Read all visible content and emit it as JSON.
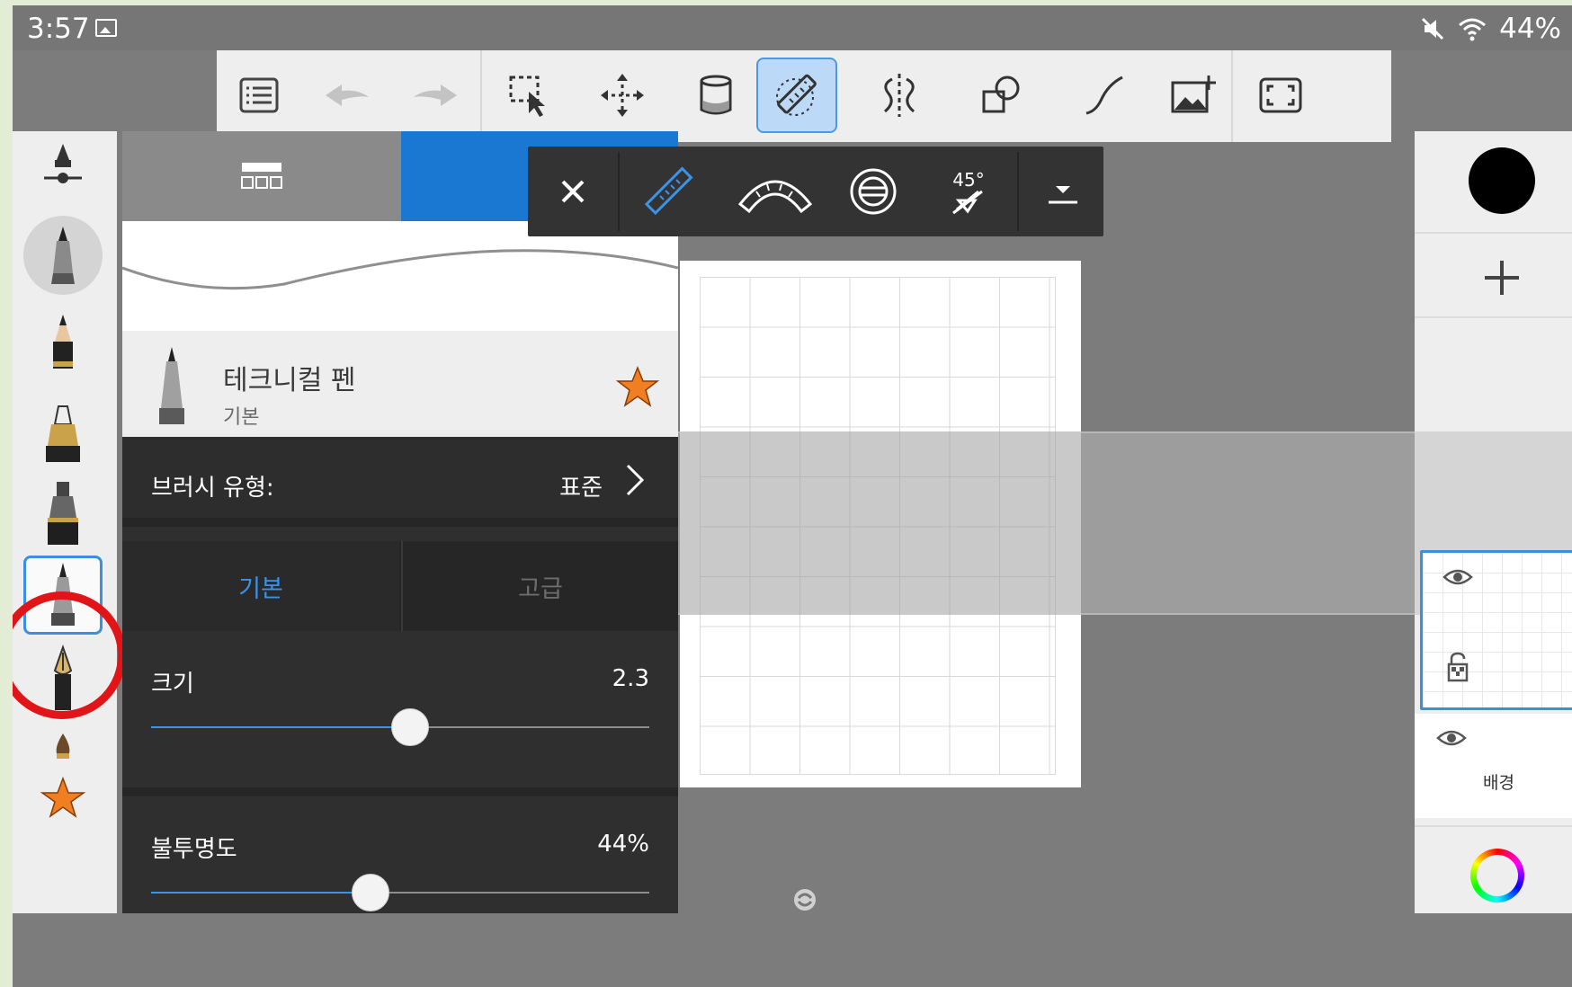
{
  "status_bar": {
    "time": "3:57",
    "battery": "44%",
    "icons": [
      "gallery-icon",
      "mute-icon",
      "wifi-icon"
    ]
  },
  "toolbar": {
    "items": [
      "list-icon",
      "undo-icon",
      "redo-icon",
      "selection-icon",
      "move-icon",
      "fill-bucket-icon",
      "ruler-icon",
      "symmetry-icon",
      "shapes-icon",
      "curve-icon",
      "add-image-icon",
      "fullscreen-icon"
    ],
    "active": "ruler-icon"
  },
  "ruler_bar": {
    "items": [
      "close-icon",
      "straight-ruler-icon",
      "ellipse-ruler-icon",
      "french-curve-icon",
      "angle-snap-icon",
      "collapse-icon"
    ],
    "angle_label": "45°"
  },
  "brush_panel": {
    "brush_name": "테크니컬 펜",
    "brush_category": "기본",
    "brush_type_label": "브러시 유형:",
    "brush_type_value": "표준",
    "tab_basic": "기본",
    "tab_advanced": "고급",
    "size_label": "크기",
    "size_value": "2.3",
    "size_fraction": 0.52,
    "opacity_label": "불투명도",
    "opacity_value": "44%",
    "opacity_fraction": 0.44
  },
  "layers": {
    "background_label": "배경"
  },
  "colors": {
    "accent": "#3c8fe0",
    "highlight_circle": "#e11417",
    "current_color": "#000000"
  }
}
